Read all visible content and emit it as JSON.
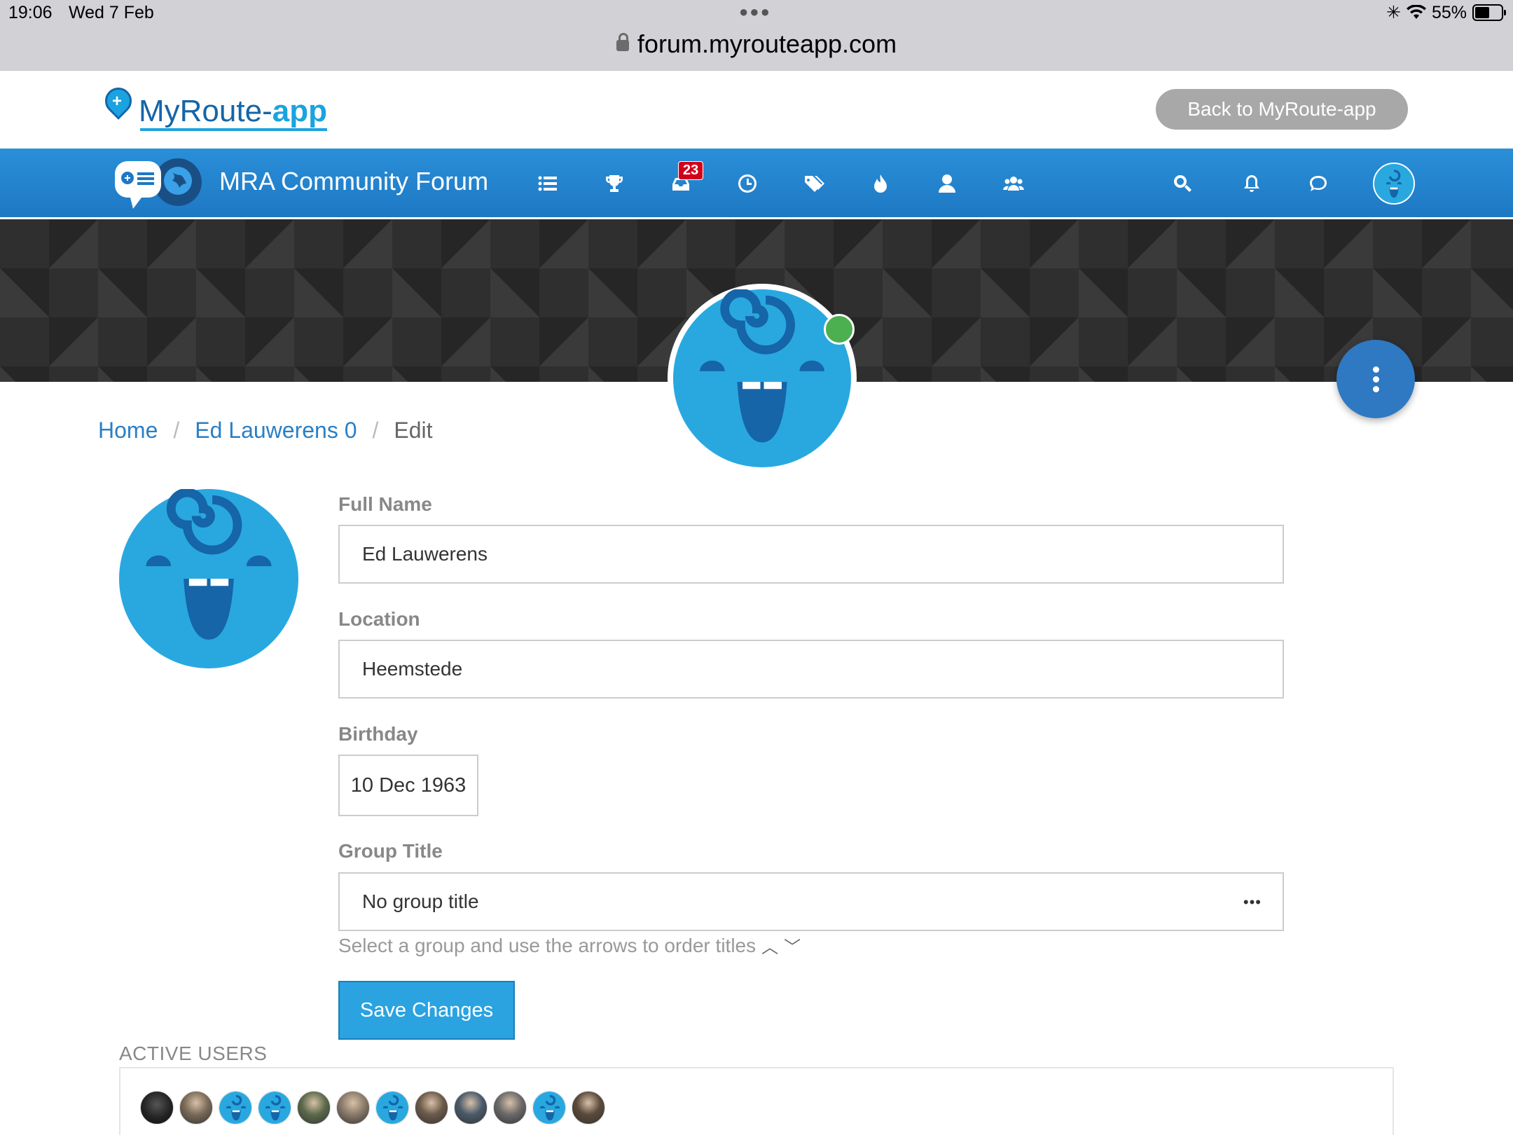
{
  "status_bar": {
    "time": "19:06",
    "date": "Wed 7 Feb",
    "battery": "55%",
    "battery_level": 0.55
  },
  "browser": {
    "url": "forum.myrouteapp.com"
  },
  "site_header": {
    "logo_main": "MyRoute-",
    "logo_app": "app",
    "back_button": "Back to MyRoute-app"
  },
  "forum_nav": {
    "title": "MRA Community Forum",
    "unread_badge": "23",
    "icons": [
      "categories-icon",
      "trophy-icon",
      "inbox-icon",
      "recent-icon",
      "tags-icon",
      "popular-icon",
      "user-icon",
      "groups-icon",
      "search-icon",
      "bell-icon",
      "chat-icon"
    ]
  },
  "breadcrumb": {
    "home": "Home",
    "user": "Ed Lauwerens 0",
    "current": "Edit",
    "separator": "/"
  },
  "form": {
    "full_name_label": "Full Name",
    "full_name_value": "Ed Lauwerens",
    "location_label": "Location",
    "location_value": "Heemstede",
    "birthday_label": "Birthday",
    "birthday_value": "10 Dec 1963",
    "group_title_label": "Group Title",
    "group_title_value": "No group title",
    "group_title_help": "Select a group and use the arrows to order titles",
    "save_button": "Save Changes"
  },
  "active_users": {
    "title": "ACTIVE USERS",
    "avatars": [
      "dark",
      "photo",
      "default",
      "default",
      "photo",
      "photo",
      "default",
      "photo",
      "photo",
      "photo",
      "default",
      "photo"
    ]
  },
  "colors": {
    "nav_blue": "#1e78c4",
    "accent": "#2aa3e0",
    "online": "#4caf50",
    "badge": "#d0021b"
  }
}
